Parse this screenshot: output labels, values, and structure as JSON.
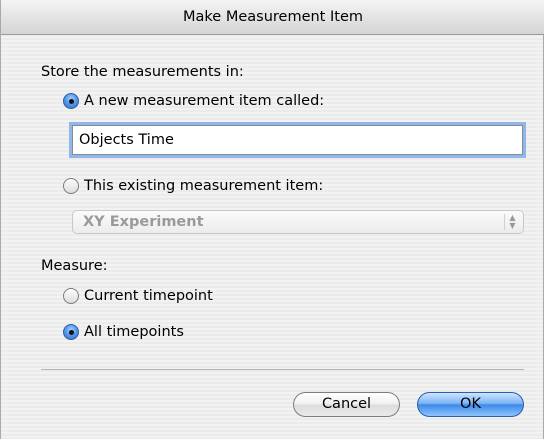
{
  "window": {
    "title": "Make Measurement Item"
  },
  "store": {
    "heading": "Store the measurements in:",
    "option_new_label": "A new measurement item called:",
    "option_new_selected": true,
    "name_value": "Objects Time",
    "option_existing_label": "This existing measurement item:",
    "option_existing_selected": false,
    "existing_popup_value": "XY Experiment",
    "stepper_up": "▲",
    "stepper_down": "▼"
  },
  "measure": {
    "heading": "Measure:",
    "option_current_label": "Current timepoint",
    "option_current_selected": false,
    "option_all_label": "All timepoints",
    "option_all_selected": true
  },
  "buttons": {
    "cancel_label": "Cancel",
    "ok_label": "OK"
  },
  "colors": {
    "accent": "#3d8ae8",
    "focus_ring": "#8fb7ea",
    "disabled_text": "#9a9a9a"
  }
}
